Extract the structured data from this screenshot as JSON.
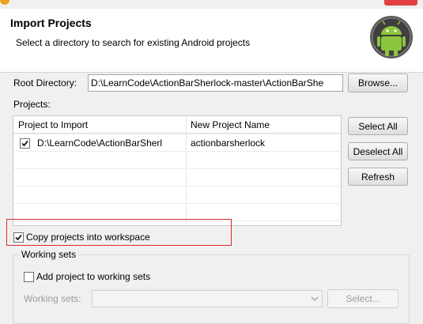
{
  "header": {
    "title": "Import Projects",
    "subtitle": "Select a directory to search for existing Android projects",
    "icon": "android-icon"
  },
  "root_directory": {
    "label": "Root Directory:",
    "value": "D:\\LearnCode\\ActionBarSherlock-master\\ActionBarShe",
    "browse_label": "Browse..."
  },
  "projects": {
    "label": "Projects:",
    "columns": [
      "Project to Import",
      "New Project Name"
    ],
    "rows": [
      {
        "checked": true,
        "path": "D:\\LearnCode\\ActionBarSherl",
        "name": "actionbarsherlock"
      }
    ]
  },
  "actions": {
    "select_all": "Select All",
    "deselect_all": "Deselect All",
    "refresh": "Refresh"
  },
  "copy_option": {
    "checked": true,
    "label": "Copy projects into workspace"
  },
  "working_sets": {
    "group_title": "Working sets",
    "add_checked": false,
    "add_label": "Add project to working sets",
    "field_label": "Working sets:",
    "field_value": "",
    "select_label": "Select..."
  },
  "colors": {
    "highlight_border": "#d92a2a",
    "android_green": "#8cc63f"
  }
}
